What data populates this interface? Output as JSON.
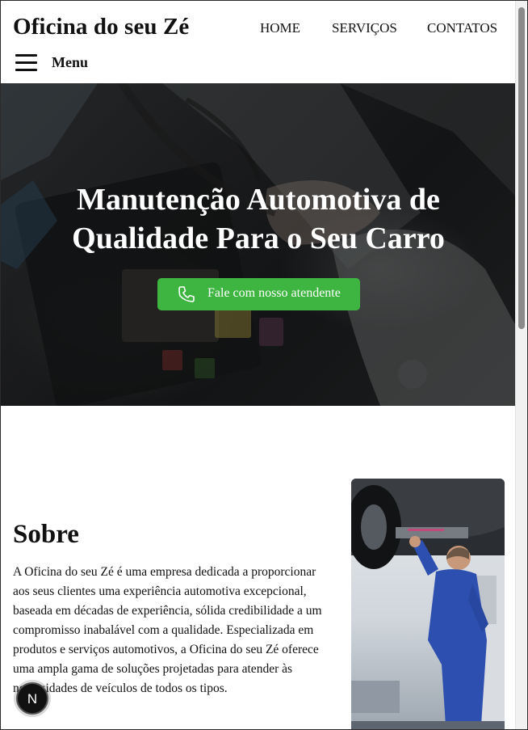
{
  "header": {
    "brand": "Oficina do seu Zé",
    "nav": [
      {
        "label": "HOME"
      },
      {
        "label": "SERVIÇOS"
      },
      {
        "label": "CONTATOS"
      }
    ],
    "menu_label": "Menu"
  },
  "hero": {
    "title": "Manutenção Automotiva de Qualidade Para o Seu Carro",
    "cta_label": "Fale com nosso atendente"
  },
  "about": {
    "title": "Sobre",
    "text": "A Oficina do seu Zé é uma empresa dedicada a proporcionar aos seus clientes uma experiência automotiva excepcional, baseada em décadas de experiência, sólida credibilidade a um compromisso inabalável com a qualidade. Especializada em produtos e serviços automotivos, a Oficina do seu Zé oferece uma ampla gama de soluções projetadas para atender às necessidades de veículos de todos os tipos."
  },
  "badge": {
    "label": "N"
  },
  "colors": {
    "accent_green": "#3fb541",
    "text": "#111111",
    "hero_overlay": "#000000"
  }
}
